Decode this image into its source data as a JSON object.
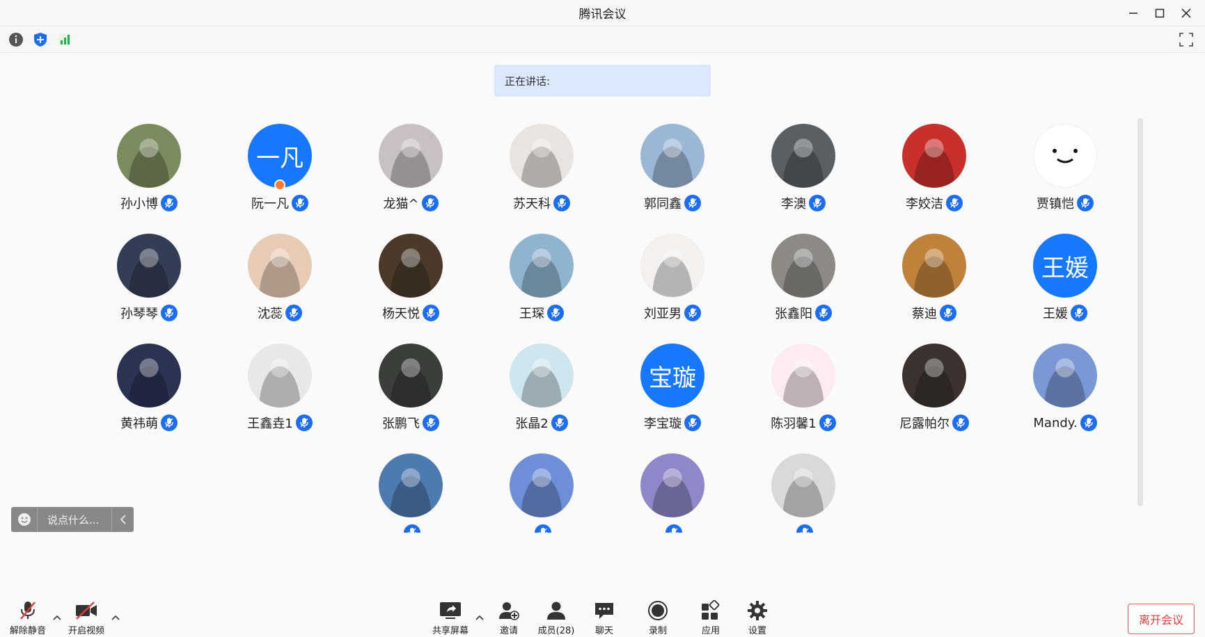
{
  "window": {
    "title": "腾讯会议"
  },
  "toolbar": {
    "icons": [
      "info-icon",
      "shield-icon",
      "signal-icon"
    ]
  },
  "speaking": {
    "label": "正在讲话:"
  },
  "participants": [
    {
      "name": "孙小博",
      "avatar_color": "#7a8b5e"
    },
    {
      "name": "阮一凡",
      "avatar_color": "#1677ff",
      "avatar_text": "一凡",
      "host": true
    },
    {
      "name": "龙猫^",
      "avatar_color": "#c9c0c4"
    },
    {
      "name": "苏天科",
      "avatar_color": "#e9e4e0"
    },
    {
      "name": "郭同鑫",
      "avatar_color": "#9bb7d6"
    },
    {
      "name": "李澳",
      "avatar_color": "#5a5f63"
    },
    {
      "name": "李姣洁",
      "avatar_color": "#c9302c"
    },
    {
      "name": "贾镇恺",
      "avatar_color": "#ffffff",
      "avatar_face": true
    },
    {
      "name": "孙琴琴",
      "avatar_color": "#333d55"
    },
    {
      "name": "沈蕊",
      "avatar_color": "#e8cbb5"
    },
    {
      "name": "杨天悦",
      "avatar_color": "#4b3a2a"
    },
    {
      "name": "王琛",
      "avatar_color": "#8fb4cf"
    },
    {
      "name": "刘亚男",
      "avatar_color": "#f3f0ee"
    },
    {
      "name": "张鑫阳",
      "avatar_color": "#8d8a86"
    },
    {
      "name": "蔡迪",
      "avatar_color": "#c0823b"
    },
    {
      "name": "王媛",
      "avatar_color": "#1677ff",
      "avatar_text": "王媛"
    },
    {
      "name": "黄祎萌",
      "avatar_color": "#2b3355"
    },
    {
      "name": "王鑫垚1",
      "avatar_color": "#e8e8e8"
    },
    {
      "name": "张鹏飞",
      "avatar_color": "#3a3f3a"
    },
    {
      "name": "张晶2",
      "avatar_color": "#cfe6ef"
    },
    {
      "name": "李宝璇",
      "avatar_color": "#1677ff",
      "avatar_text": "宝璇"
    },
    {
      "name": "陈羽馨1",
      "avatar_color": "#fdecef"
    },
    {
      "name": "尼露帕尔",
      "avatar_color": "#3b3230"
    },
    {
      "name": "Mandy.",
      "avatar_color": "#7b98d6"
    },
    {
      "name": "",
      "avatar_color": "#4d7ab0"
    },
    {
      "name": "",
      "avatar_color": "#6d8fd8"
    },
    {
      "name": "",
      "avatar_color": "#8e87c9"
    },
    {
      "name": "",
      "avatar_color": "#d9d9d9"
    }
  ],
  "chat": {
    "placeholder": "说点什么..."
  },
  "controls": {
    "unmute": "解除静音",
    "start_video": "开启视频",
    "share_screen": "共享屏幕",
    "invite": "邀请",
    "members": "成员(28)",
    "chat": "聊天",
    "record": "录制",
    "apps": "应用",
    "settings": "设置",
    "leave": "离开会议"
  },
  "colors": {
    "accent": "#1677ff",
    "leave": "#e03c3c",
    "speaking_bg": "#dce9fc"
  }
}
